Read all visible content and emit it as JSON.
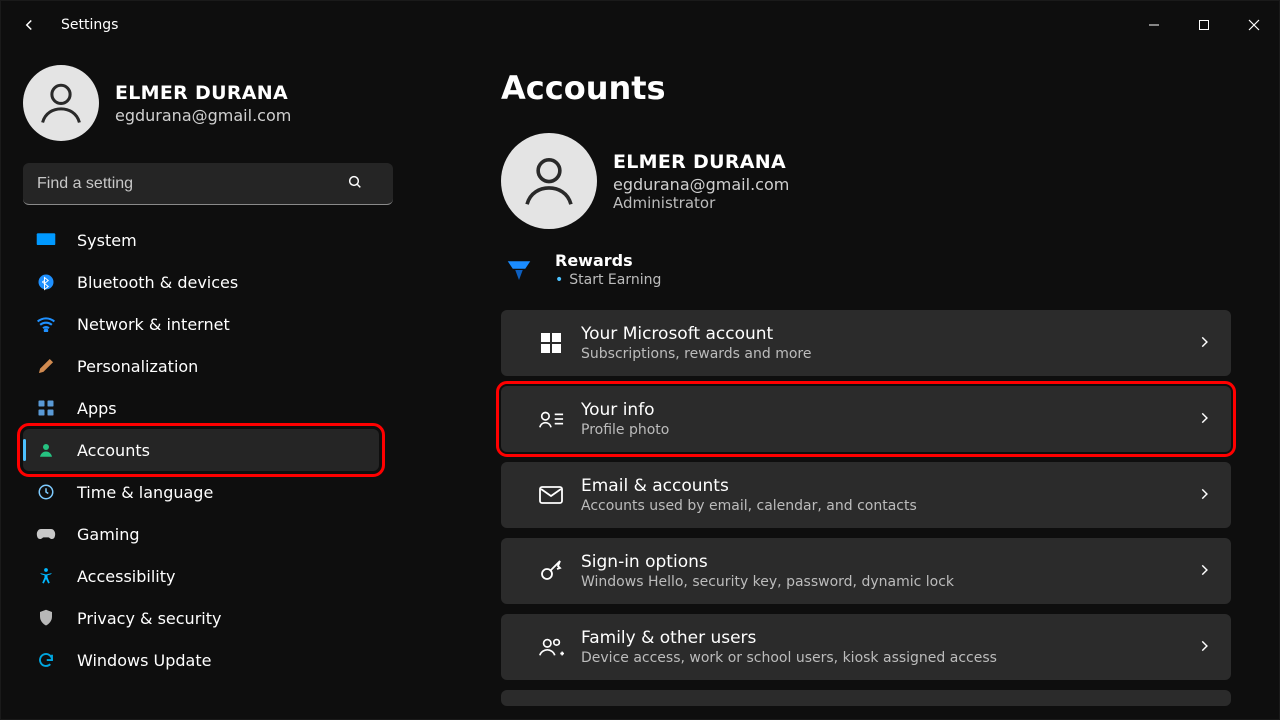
{
  "window": {
    "title": "Settings"
  },
  "user": {
    "name": "ELMER DURANA",
    "email": "egdurana@gmail.com",
    "role": "Administrator"
  },
  "search": {
    "placeholder": "Find a setting"
  },
  "sidebar": {
    "items": [
      {
        "label": "System"
      },
      {
        "label": "Bluetooth & devices"
      },
      {
        "label": "Network & internet"
      },
      {
        "label": "Personalization"
      },
      {
        "label": "Apps"
      },
      {
        "label": "Accounts"
      },
      {
        "label": "Time & language"
      },
      {
        "label": "Gaming"
      },
      {
        "label": "Accessibility"
      },
      {
        "label": "Privacy & security"
      },
      {
        "label": "Windows Update"
      }
    ]
  },
  "page": {
    "title": "Accounts",
    "rewards": {
      "title": "Rewards",
      "sub": "Start Earning"
    },
    "cards": [
      {
        "title": "Your Microsoft account",
        "sub": "Subscriptions, rewards and more"
      },
      {
        "title": "Your info",
        "sub": "Profile photo"
      },
      {
        "title": "Email & accounts",
        "sub": "Accounts used by email, calendar, and contacts"
      },
      {
        "title": "Sign-in options",
        "sub": "Windows Hello, security key, password, dynamic lock"
      },
      {
        "title": "Family & other users",
        "sub": "Device access, work or school users, kiosk assigned access"
      }
    ]
  }
}
